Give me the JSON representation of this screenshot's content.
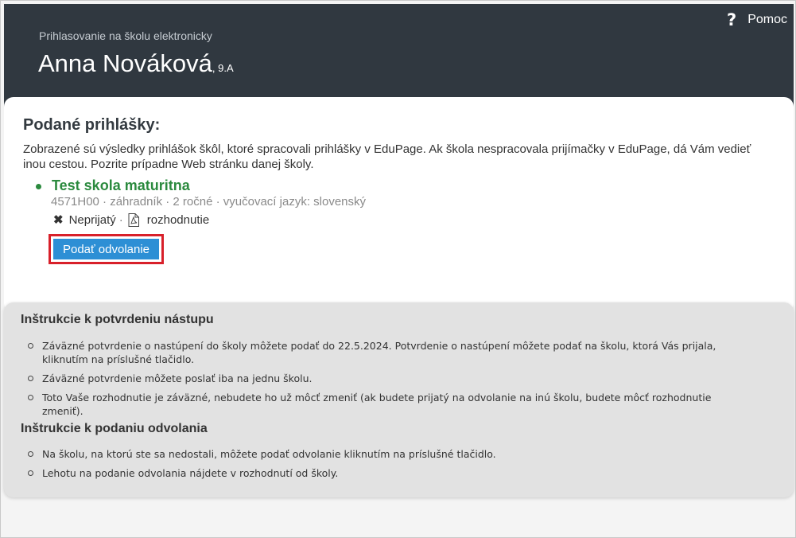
{
  "header": {
    "help_label": "Pomoc",
    "subtitle": "Prihlasovanie na školu elektronicky",
    "student_name": "Anna Nováková",
    "student_class": ", 9.A"
  },
  "applications": {
    "title": "Podané prihlášky:",
    "intro": "Zobrazené sú výsledky prihlášok škôl, ktoré spracovali prihlášky v EduPage. Ak škola nespracovala prijímačky v EduPage, dá Vám vedieť inou cestou. Pozrite prípadne Web stránku danej školy.",
    "school": {
      "name": "Test skola maturitna",
      "meta": "4571H00 · záhradník · 2 ročné · vyučovací jazyk: slovenský",
      "status": "Neprijatý",
      "separator": "·",
      "decision_label": "rozhodnutie"
    },
    "appeal_button": "Podať odvolanie"
  },
  "instructions": {
    "confirm_title": "Inštrukcie k potvrdeniu nástupu",
    "confirm_items": [
      "Záväzné potvrdenie o nastúpení do školy môžete podať do 22.5.2024. Potvrdenie o nastúpení môžete podať na školu, ktorá Vás prijala, kliknutím na príslušné tlačidlo.",
      "Záväzné potvrdenie môžete poslať iba na jednu školu.",
      "Toto Vaše rozhodnutie je záväzné, nebudete ho už môcť zmeniť (ak budete prijatý na odvolanie na inú školu, budete môcť rozhodnutie zmeniť)."
    ],
    "appeal_title": "Inštrukcie k podaniu odvolania",
    "appeal_items": [
      "Na školu, na ktorú ste sa nedostali, môžete podať odvolanie kliknutím na príslušné tlačidlo.",
      "Lehotu na podanie odvolania nájdete v rozhodnutí od školy."
    ]
  },
  "colors": {
    "header_bg": "#303840",
    "school_green": "#2b8a3e",
    "button_blue": "#2d8fd5",
    "highlight_red": "#d8202a"
  },
  "icons": {
    "help": "question-mark-icon",
    "status": "x-icon",
    "decision": "pdf-file-icon",
    "school_bullet": "green-dot-icon"
  }
}
